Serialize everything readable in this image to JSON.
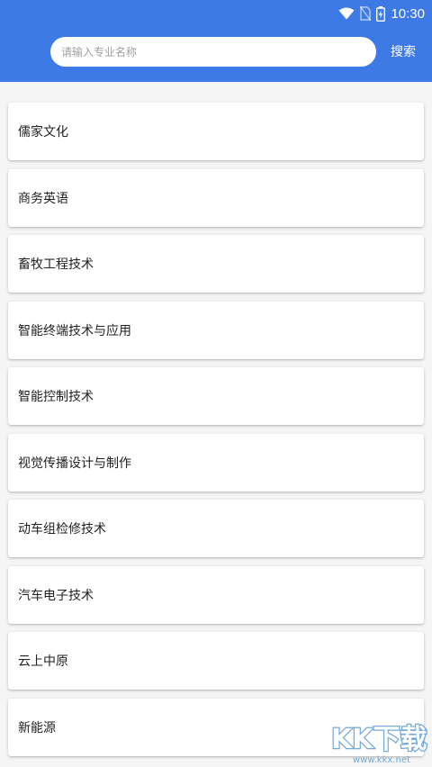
{
  "status_bar": {
    "time": "10:30",
    "icons": [
      "wifi-icon",
      "no-sim-icon",
      "battery-icon"
    ]
  },
  "search": {
    "placeholder": "请输入专业名称",
    "button_label": "搜索"
  },
  "majors": [
    "儒家文化",
    "商务英语",
    "畜牧工程技术",
    "智能终端技术与应用",
    "智能控制技术",
    "视觉传播设计与制作",
    "动车组检修技术",
    "汽车电子技术",
    "云上中原",
    "新能源"
  ],
  "watermark": {
    "logo_text": "KK下载",
    "url": "www.kkx.net"
  },
  "colors": {
    "header": "#3e7ae6",
    "background": "#f5f5f5",
    "card": "#ffffff",
    "watermark": "#5b9bd5"
  }
}
